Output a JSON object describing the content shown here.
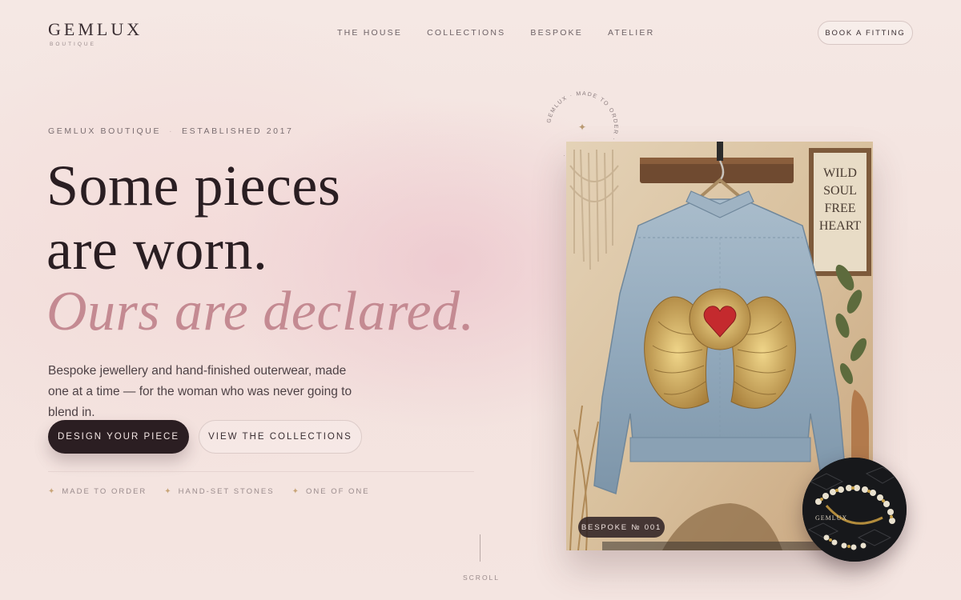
{
  "header": {
    "logo": "GEMLUX",
    "logo_sub": "BOUTIQUE",
    "nav": [
      {
        "label": "THE HOUSE"
      },
      {
        "label": "COLLECTIONS"
      },
      {
        "label": "BESPOKE"
      },
      {
        "label": "ATELIER"
      }
    ],
    "cta": "BOOK A FITTING"
  },
  "hero": {
    "eyebrow_brand": "GEMLUX BOUTIQUE",
    "eyebrow_sep": "·",
    "eyebrow_est": "ESTABLISHED 2017",
    "headline_line1": "Some pieces",
    "headline_line2": "are worn.",
    "headline_line3": "Ours are declared.",
    "lede": "Bespoke jewellery and hand-finished outerwear, made one at a time — for the woman who was never going to blend in.",
    "primary_cta": "DESIGN YOUR PIECE",
    "secondary_cta": "VIEW THE COLLECTIONS",
    "features": [
      {
        "label": "MADE TO ORDER"
      },
      {
        "label": "HAND-SET STONES"
      },
      {
        "label": "ONE OF ONE"
      }
    ],
    "scroll": "SCROLL"
  },
  "media": {
    "badge_text": "GEMLUX · MADE TO ORDER · ONE OF ONE · ",
    "sign_line1": "WILD",
    "sign_line2": "SOUL",
    "sign_line3": "FREE",
    "sign_line4": "HEART",
    "tag": "BESPOKE № 001",
    "jewel_brand": "GEMLUX"
  },
  "colors": {
    "accent_rose": "#c48a92",
    "ink": "#2b1e22",
    "gold": "#c9a67a",
    "background": "#f4e5e1"
  },
  "icons": [
    "sparkle-icon",
    "star-icon",
    "hanger-icon",
    "winged-heart-icon"
  ]
}
